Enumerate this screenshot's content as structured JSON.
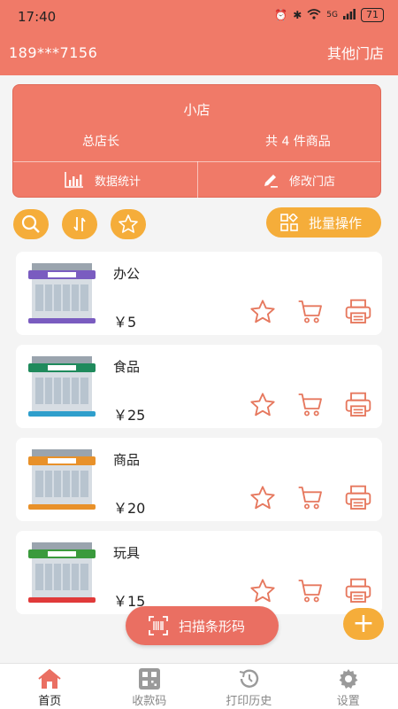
{
  "status_bar": {
    "time": "17:40",
    "signal": "5G",
    "battery": "71"
  },
  "header": {
    "phone": "189***7156",
    "other_stores": "其他门店"
  },
  "store_card": {
    "name": "小店",
    "owner": "总店长",
    "product_count": "共 4 件商品",
    "stats_label": "数据统计",
    "edit_label": "修改门店"
  },
  "toolbar": {
    "bulk_label": "批量操作"
  },
  "products": [
    {
      "name": "办公",
      "price": "￥5",
      "awning": "#7a5cc0"
    },
    {
      "name": "食品",
      "price": "￥25",
      "awning": "#1f8a5c"
    },
    {
      "name": "商品",
      "price": "￥20",
      "awning": "#e8912a"
    },
    {
      "name": "玩具",
      "price": "￥15",
      "awning": "#3a9a3c"
    }
  ],
  "scan_button": {
    "label": "扫描条形码"
  },
  "tabs": [
    {
      "label": "首页",
      "icon": "home-icon"
    },
    {
      "label": "收款码",
      "icon": "qr-code-icon"
    },
    {
      "label": "打印历史",
      "icon": "history-icon"
    },
    {
      "label": "设置",
      "icon": "gear-icon"
    }
  ],
  "colors": {
    "brand": "#f07a68",
    "accent": "#f5ad3a",
    "icon": "#e6785e"
  }
}
